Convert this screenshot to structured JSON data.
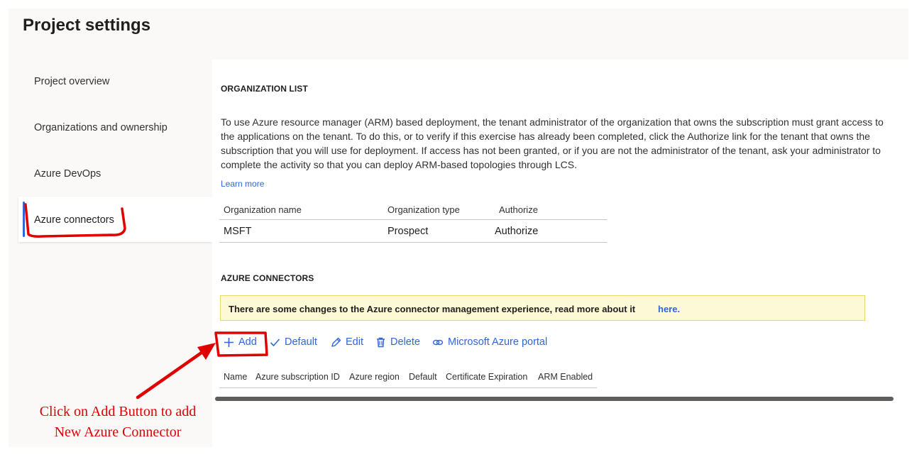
{
  "page": {
    "title": "Project settings"
  },
  "sidebar": {
    "items": [
      {
        "label": "Project overview"
      },
      {
        "label": "Organizations and ownership"
      },
      {
        "label": "Azure DevOps"
      },
      {
        "label": "Azure connectors",
        "selected": true
      }
    ]
  },
  "org_section": {
    "heading": "ORGANIZATION LIST",
    "description": "To use Azure resource manager (ARM) based deployment, the tenant administrator of the organization that owns the subscription must grant access to the applications on the tenant. To do this, or to verify if this exercise has already been completed, click the Authorize link for the tenant that owns the subscription that you will use for deployment. If access has not been granted, or if you are not the administrator of the tenant, ask your administrator to complete the activity so that you can deploy ARM-based topologies through LCS.",
    "learn_more": "Learn more",
    "table": {
      "headers": [
        "Organization name",
        "Organization type",
        "Authorize"
      ],
      "rows": [
        {
          "name": "MSFT",
          "type": "Prospect",
          "authorize": "Authorize"
        }
      ]
    }
  },
  "connectors_section": {
    "heading": "AZURE CONNECTORS",
    "notice": {
      "text": "There are some changes to the Azure connector management experience, read more about it",
      "link": "here."
    },
    "commands": [
      {
        "label": "Add",
        "icon": "plus-icon"
      },
      {
        "label": "Default",
        "icon": "checkmark-icon"
      },
      {
        "label": "Edit",
        "icon": "pencil-icon"
      },
      {
        "label": "Delete",
        "icon": "trash-icon"
      },
      {
        "label": "Microsoft Azure portal",
        "icon": "link-icon"
      }
    ],
    "table_headers": [
      "Name",
      "Azure subscription ID",
      "Azure region",
      "Default",
      "Certificate Expiration",
      "ARM Enabled"
    ]
  },
  "annotation": {
    "text_line1": "Click on Add Button to add",
    "text_line2": "New Azure Connector",
    "color": "#e00000"
  },
  "colors": {
    "accent": "#2f66d8",
    "notice_bg": "#fdf8d6",
    "sidebar_bg": "#faf9f8"
  }
}
